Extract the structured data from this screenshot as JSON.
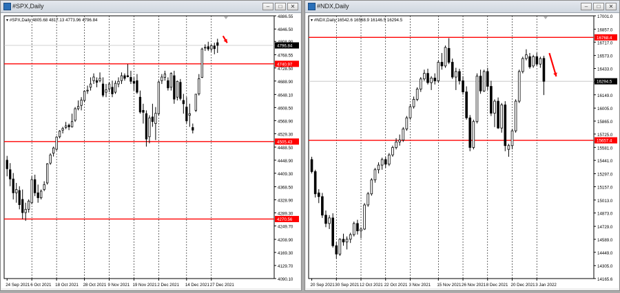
{
  "windows": [
    {
      "title": "#SPX,Daily",
      "buttons": {
        "minimize": "‒",
        "maximize": "□",
        "close": "✕"
      },
      "chart_data": {
        "type": "candlestick",
        "info": "▾ #SPX,Daily  4805.68 4817.13 4773.96 4796.84",
        "ylim": [
          4090.1,
          4886.55
        ],
        "yticks": [
          "4886.55",
          "4846.50",
          "4808.90",
          "4768.55",
          "4728.50",
          "4688.90",
          "4648.10",
          "4608.50",
          "4568.90",
          "4529.30",
          "4488.50",
          "4448.90",
          "4409.30",
          "4368.50",
          "4328.90",
          "4289.30",
          "4249.70",
          "4208.90",
          "4169.30",
          "4129.70",
          "4090.10"
        ],
        "xlabels": [
          "24 Sep 2021",
          "6 Oct 2021",
          "18 Oct 2021",
          "28 Oct 2021",
          "9 Nov 2021",
          "19 Nov 2021",
          "2 Dec 2021",
          "14 Dec 2021",
          "27 Dec 2021"
        ],
        "levels": [
          {
            "value": 4740.97,
            "label": "4740.97"
          },
          {
            "value": 4505.43,
            "label": "4505.43"
          },
          {
            "value": 4270.56,
            "label": "4270.56"
          }
        ],
        "current": {
          "value": 4796.84,
          "label": "4796.84"
        },
        "candles": [
          [
            4449,
            4462,
            4400,
            4423
          ],
          [
            4420,
            4440,
            4370,
            4392
          ],
          [
            4392,
            4410,
            4330,
            4350
          ],
          [
            4350,
            4380,
            4320,
            4360
          ],
          [
            4357,
            4370,
            4300,
            4314
          ],
          [
            4330,
            4360,
            4270,
            4290
          ],
          [
            4290,
            4320,
            4265,
            4300
          ],
          [
            4300,
            4330,
            4290,
            4325
          ],
          [
            4320,
            4400,
            4315,
            4390
          ],
          [
            4390,
            4405,
            4340,
            4350
          ],
          [
            4350,
            4375,
            4320,
            4335
          ],
          [
            4335,
            4360,
            4330,
            4355
          ],
          [
            4360,
            4385,
            4355,
            4375
          ],
          [
            4380,
            4440,
            4375,
            4438
          ],
          [
            4440,
            4470,
            4435,
            4465
          ],
          [
            4470,
            4490,
            4460,
            4486
          ],
          [
            4482,
            4522,
            4478,
            4519
          ],
          [
            4520,
            4540,
            4515,
            4537
          ],
          [
            4540,
            4550,
            4530,
            4545
          ],
          [
            4548,
            4565,
            4543,
            4553
          ],
          [
            4555,
            4560,
            4540,
            4550
          ],
          [
            4550,
            4590,
            4548,
            4566
          ],
          [
            4570,
            4610,
            4565,
            4605
          ],
          [
            4605,
            4630,
            4600,
            4612
          ],
          [
            4615,
            4640,
            4600,
            4631
          ],
          [
            4630,
            4660,
            4625,
            4658
          ],
          [
            4660,
            4675,
            4650,
            4661
          ],
          [
            4670,
            4700,
            4660,
            4680
          ],
          [
            4690,
            4712,
            4680,
            4701
          ],
          [
            4690,
            4700,
            4670,
            4685
          ],
          [
            4690,
            4715,
            4685,
            4697
          ],
          [
            4680,
            4700,
            4640,
            4646
          ],
          [
            4655,
            4680,
            4640,
            4662
          ],
          [
            4665,
            4686,
            4655,
            4680
          ],
          [
            4670,
            4690,
            4640,
            4650
          ],
          [
            4655,
            4690,
            4650,
            4682
          ],
          [
            4680,
            4700,
            4670,
            4688
          ],
          [
            4690,
            4715,
            4680,
            4705
          ],
          [
            4705,
            4712,
            4690,
            4697
          ],
          [
            4705,
            4740,
            4700,
            4702
          ],
          [
            4700,
            4720,
            4680,
            4688
          ],
          [
            4688,
            4700,
            4660,
            4682
          ],
          [
            4690,
            4710,
            4650,
            4655
          ],
          [
            4640,
            4660,
            4590,
            4595
          ],
          [
            4600,
            4620,
            4560,
            4594
          ],
          [
            4590,
            4600,
            4490,
            4513
          ],
          [
            4520,
            4585,
            4500,
            4577
          ],
          [
            4580,
            4620,
            4550,
            4566
          ],
          [
            4560,
            4610,
            4510,
            4591
          ],
          [
            4590,
            4690,
            4585,
            4686
          ],
          [
            4690,
            4710,
            4680,
            4701
          ],
          [
            4700,
            4720,
            4690,
            4710
          ],
          [
            4690,
            4700,
            4660,
            4668
          ],
          [
            4670,
            4715,
            4660,
            4712
          ],
          [
            4705,
            4720,
            4620,
            4634
          ],
          [
            4640,
            4690,
            4630,
            4688
          ],
          [
            4685,
            4695,
            4630,
            4636
          ],
          [
            4630,
            4650,
            4590,
            4620
          ],
          [
            4610,
            4640,
            4560,
            4568
          ],
          [
            4585,
            4620,
            4550,
            4590
          ],
          [
            4548,
            4560,
            4530,
            4540
          ],
          [
            4600,
            4650,
            4595,
            4649
          ],
          [
            4650,
            4710,
            4645,
            4696
          ],
          [
            4700,
            4790,
            4698,
            4786
          ],
          [
            4790,
            4800,
            4780,
            4791
          ],
          [
            4793,
            4808,
            4780,
            4786
          ],
          [
            4786,
            4800,
            4778,
            4796
          ],
          [
            4795,
            4805,
            4770,
            4787
          ],
          [
            4805,
            4817,
            4774,
            4797
          ]
        ],
        "xlabel": "",
        "ylabel": ""
      }
    },
    {
      "title": "#NDX,Daily",
      "buttons": {
        "minimize": "‒",
        "maximize": "□",
        "close": "✕"
      },
      "chart_data": {
        "type": "candlestick",
        "info": "▾ #NDX,Daily  16542.6 16568.9 16146.5 16294.5",
        "ylim": [
          14165.6,
          17001.0
        ],
        "yticks": [
          "17001.0",
          "16857.0",
          "16717.0",
          "16573.0",
          "16433.0",
          "16289.0",
          "16149.0",
          "16005.0",
          "15865.0",
          "15725.0",
          "15581.0",
          "15441.0",
          "15297.0",
          "15157.0",
          "15013.0",
          "14873.0",
          "14729.0",
          "14589.0",
          "14449.0",
          "14305.0",
          "14165.6"
        ],
        "xlabels": [
          "20 Sep 2021",
          "30 Sep 2021",
          "12 Oct 2021",
          "22 Oct 2021",
          "3 Nov 2021",
          "15 Nov 2021",
          "26 Nov 2021",
          "8 Dec 2021",
          "20 Dec 2021",
          "3 Jan 2022"
        ],
        "levels": [
          {
            "value": 16768.4,
            "label": "16768.4"
          },
          {
            "value": 15657.4,
            "label": "15657.4"
          }
        ],
        "current": {
          "value": 16294.5,
          "label": "16294.5"
        },
        "candles": [
          [
            15450,
            15480,
            15300,
            15320
          ],
          [
            15320,
            15340,
            15040,
            15080
          ],
          [
            15090,
            15130,
            14980,
            15050
          ],
          [
            15050,
            15090,
            14820,
            14850
          ],
          [
            14850,
            14900,
            14720,
            14760
          ],
          [
            14760,
            14850,
            14700,
            14820
          ],
          [
            14820,
            14870,
            14500,
            14520
          ],
          [
            14520,
            14560,
            14380,
            14430
          ],
          [
            14430,
            14600,
            14410,
            14590
          ],
          [
            14590,
            14650,
            14520,
            14560
          ],
          [
            14560,
            14620,
            14480,
            14590
          ],
          [
            14590,
            14660,
            14550,
            14640
          ],
          [
            14640,
            14780,
            14620,
            14760
          ],
          [
            14760,
            14800,
            14640,
            14680
          ],
          [
            14680,
            14720,
            14600,
            14700
          ],
          [
            14700,
            14980,
            14690,
            14960
          ],
          [
            14960,
            15100,
            14940,
            15080
          ],
          [
            15080,
            15250,
            15060,
            15230
          ],
          [
            15230,
            15360,
            15200,
            15340
          ],
          [
            15340,
            15420,
            15300,
            15390
          ],
          [
            15390,
            15470,
            15340,
            15450
          ],
          [
            15450,
            15480,
            15360,
            15400
          ],
          [
            15400,
            15520,
            15380,
            15500
          ],
          [
            15500,
            15600,
            15480,
            15580
          ],
          [
            15580,
            15680,
            15560,
            15640
          ],
          [
            15640,
            15720,
            15600,
            15660
          ],
          [
            15660,
            15800,
            15640,
            15780
          ],
          [
            15780,
            15920,
            15760,
            15900
          ],
          [
            15900,
            16050,
            15880,
            16020
          ],
          [
            16020,
            16130,
            16000,
            16100
          ],
          [
            16100,
            16230,
            16080,
            16210
          ],
          [
            16210,
            16340,
            16180,
            16320
          ],
          [
            16320,
            16420,
            16300,
            16380
          ],
          [
            16380,
            16430,
            16260,
            16280
          ],
          [
            16280,
            16350,
            16200,
            16330
          ],
          [
            16330,
            16380,
            16260,
            16300
          ],
          [
            16300,
            16520,
            16280,
            16500
          ],
          [
            16500,
            16600,
            16420,
            16460
          ],
          [
            16460,
            16680,
            16440,
            16660
          ],
          [
            16650,
            16760,
            16480,
            16500
          ],
          [
            16500,
            16540,
            16320,
            16340
          ],
          [
            16340,
            16440,
            16200,
            16400
          ],
          [
            16400,
            16430,
            16260,
            16300
          ],
          [
            16300,
            16350,
            16150,
            16180
          ],
          [
            16180,
            16240,
            15880,
            15900
          ],
          [
            15900,
            15930,
            15540,
            15580
          ],
          [
            15580,
            15880,
            15560,
            15860
          ],
          [
            15860,
            16380,
            15840,
            16350
          ],
          [
            16350,
            16420,
            16160,
            16190
          ],
          [
            16190,
            16420,
            16180,
            16400
          ],
          [
            16400,
            16440,
            16200,
            16240
          ],
          [
            16240,
            16300,
            15920,
            15950
          ],
          [
            15950,
            16100,
            15800,
            16080
          ],
          [
            16080,
            16120,
            15780,
            15790
          ],
          [
            15790,
            16060,
            15740,
            16040
          ],
          [
            16040,
            16080,
            15540,
            15600
          ],
          [
            15560,
            15620,
            15480,
            15600
          ],
          [
            15600,
            15780,
            15560,
            15760
          ],
          [
            15760,
            16100,
            15740,
            16080
          ],
          [
            16080,
            16420,
            16060,
            16400
          ],
          [
            16400,
            16560,
            16380,
            16540
          ],
          [
            16540,
            16640,
            16520,
            16580
          ],
          [
            16560,
            16600,
            16430,
            16450
          ],
          [
            16460,
            16580,
            16440,
            16560
          ],
          [
            16560,
            16600,
            16460,
            16480
          ],
          [
            16480,
            16560,
            16440,
            16540
          ],
          [
            16542,
            16569,
            16146,
            16294
          ]
        ],
        "xlabel": "",
        "ylabel": ""
      }
    }
  ]
}
